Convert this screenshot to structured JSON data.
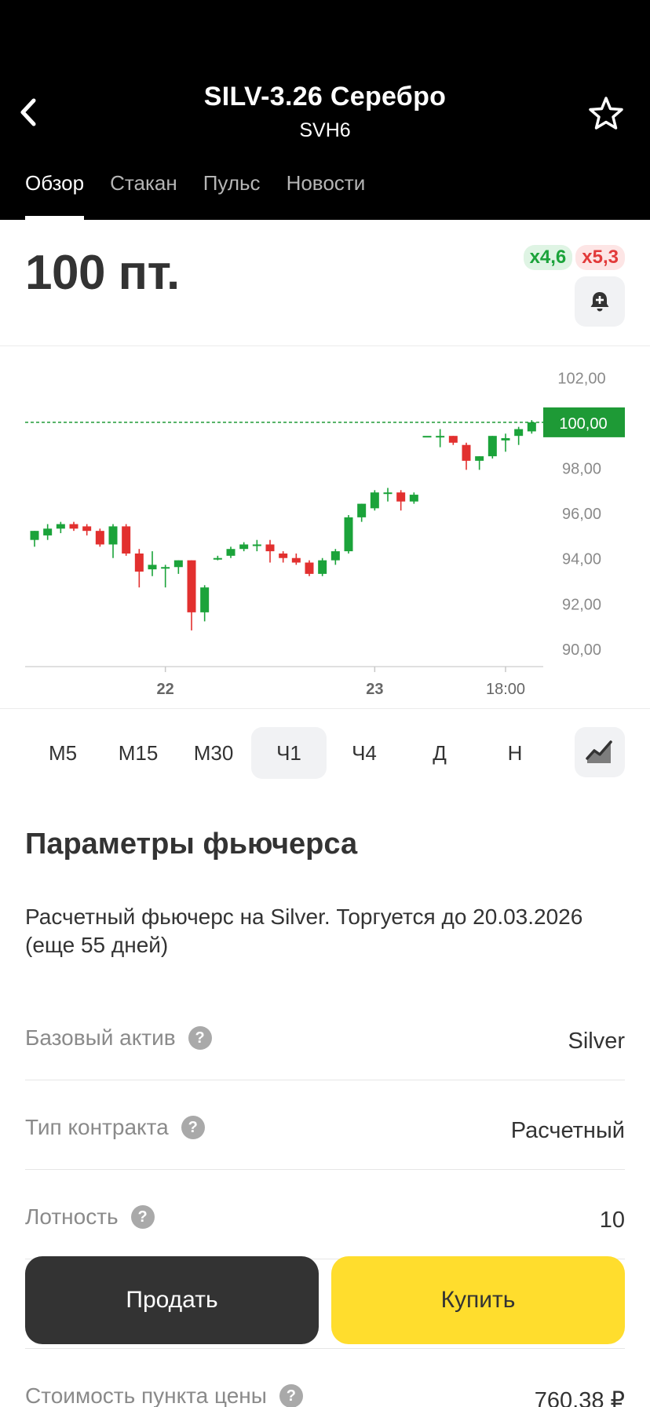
{
  "header": {
    "title": "SILV-3.26 Серебро",
    "subtitle": "SVH6",
    "tabs": [
      {
        "label": "Обзор",
        "active": true
      },
      {
        "label": "Стакан",
        "active": false
      },
      {
        "label": "Пульс",
        "active": false
      },
      {
        "label": "Новости",
        "active": false
      }
    ]
  },
  "price": {
    "value": "100 пт.",
    "leverage_long": "x4,6",
    "leverage_short": "x5,3"
  },
  "chart_data": {
    "type": "candlestick",
    "current_price": 100.0,
    "current_price_label": "100,00",
    "ylim": [
      89.2,
      102.6
    ],
    "y_ticks": [
      {
        "value": 102,
        "label": "102,00"
      },
      {
        "value": 98,
        "label": "98,00"
      },
      {
        "value": 96,
        "label": "96,00"
      },
      {
        "value": 94,
        "label": "94,00"
      },
      {
        "value": 92,
        "label": "92,00"
      },
      {
        "value": 90,
        "label": "90,00"
      }
    ],
    "x_ticks": [
      {
        "index": 10,
        "label": "22"
      },
      {
        "index": 26,
        "label": "23"
      },
      {
        "index": 36,
        "label": "18:00"
      }
    ],
    "candles": [
      {
        "o": 94.8,
        "h": 95.2,
        "l": 94.5,
        "c": 95.2
      },
      {
        "o": 95.0,
        "h": 95.5,
        "l": 94.8,
        "c": 95.3
      },
      {
        "o": 95.3,
        "h": 95.6,
        "l": 95.1,
        "c": 95.5
      },
      {
        "o": 95.5,
        "h": 95.6,
        "l": 95.2,
        "c": 95.3
      },
      {
        "o": 95.4,
        "h": 95.5,
        "l": 95.0,
        "c": 95.2
      },
      {
        "o": 95.2,
        "h": 95.3,
        "l": 94.5,
        "c": 94.6
      },
      {
        "o": 94.6,
        "h": 95.5,
        "l": 94.0,
        "c": 95.4
      },
      {
        "o": 95.4,
        "h": 95.5,
        "l": 94.1,
        "c": 94.2
      },
      {
        "o": 94.2,
        "h": 94.4,
        "l": 92.7,
        "c": 93.4
      },
      {
        "o": 93.5,
        "h": 94.3,
        "l": 93.2,
        "c": 93.7
      },
      {
        "o": 93.6,
        "h": 93.7,
        "l": 92.7,
        "c": 93.6
      },
      {
        "o": 93.6,
        "h": 93.9,
        "l": 93.3,
        "c": 93.9
      },
      {
        "o": 93.9,
        "h": 93.9,
        "l": 90.8,
        "c": 91.6
      },
      {
        "o": 91.6,
        "h": 92.8,
        "l": 91.2,
        "c": 92.7
      },
      {
        "o": 94.0,
        "h": 94.1,
        "l": 93.9,
        "c": 94.0
      },
      {
        "o": 94.1,
        "h": 94.5,
        "l": 94.0,
        "c": 94.4
      },
      {
        "o": 94.4,
        "h": 94.7,
        "l": 94.3,
        "c": 94.6
      },
      {
        "o": 94.6,
        "h": 94.8,
        "l": 94.3,
        "c": 94.6
      },
      {
        "o": 94.6,
        "h": 94.8,
        "l": 93.8,
        "c": 94.3
      },
      {
        "o": 94.2,
        "h": 94.3,
        "l": 93.8,
        "c": 94.0
      },
      {
        "o": 94.0,
        "h": 94.2,
        "l": 93.7,
        "c": 93.8
      },
      {
        "o": 93.8,
        "h": 93.9,
        "l": 93.2,
        "c": 93.3
      },
      {
        "o": 93.3,
        "h": 94.0,
        "l": 93.2,
        "c": 93.9
      },
      {
        "o": 93.9,
        "h": 94.4,
        "l": 93.7,
        "c": 94.3
      },
      {
        "o": 94.3,
        "h": 95.9,
        "l": 94.2,
        "c": 95.8
      },
      {
        "o": 95.8,
        "h": 96.4,
        "l": 95.6,
        "c": 96.4
      },
      {
        "o": 96.2,
        "h": 97.0,
        "l": 96.1,
        "c": 96.9
      },
      {
        "o": 96.9,
        "h": 97.1,
        "l": 96.5,
        "c": 96.9
      },
      {
        "o": 96.9,
        "h": 97.0,
        "l": 96.1,
        "c": 96.5
      },
      {
        "o": 96.5,
        "h": 96.9,
        "l": 96.4,
        "c": 96.8
      },
      {
        "o": 99.4,
        "h": 99.4,
        "l": 99.4,
        "c": 99.4
      },
      {
        "o": 99.4,
        "h": 99.7,
        "l": 98.9,
        "c": 99.4
      },
      {
        "o": 99.4,
        "h": 99.4,
        "l": 99.0,
        "c": 99.1
      },
      {
        "o": 99.0,
        "h": 99.1,
        "l": 97.9,
        "c": 98.3
      },
      {
        "o": 98.3,
        "h": 98.5,
        "l": 97.9,
        "c": 98.5
      },
      {
        "o": 98.5,
        "h": 99.4,
        "l": 98.4,
        "c": 99.4
      },
      {
        "o": 99.2,
        "h": 99.5,
        "l": 98.7,
        "c": 99.3
      },
      {
        "o": 99.4,
        "h": 99.8,
        "l": 99.0,
        "c": 99.7
      },
      {
        "o": 99.6,
        "h": 100.1,
        "l": 99.5,
        "c": 100.0
      }
    ]
  },
  "periods": [
    {
      "label": "M5",
      "active": false
    },
    {
      "label": "M15",
      "active": false
    },
    {
      "label": "M30",
      "active": false
    },
    {
      "label": "Ч1",
      "active": true
    },
    {
      "label": "Ч4",
      "active": false
    },
    {
      "label": "Д",
      "active": false
    },
    {
      "label": "Н",
      "active": false
    }
  ],
  "params": {
    "title": "Параметры фьючерса",
    "description": "Расчетный фьючерс на Silver. Торгуется до 20.03.2026 (еще 55 дней)",
    "rows": [
      {
        "label": "Базовый актив",
        "value": "Silver"
      },
      {
        "label": "Тип контракта",
        "value": "Расчетный"
      },
      {
        "label": "Лотность",
        "value": "10"
      },
      {
        "label": "",
        "value": ""
      },
      {
        "label": "Стоимость пункта цены",
        "value": "760,38 ₽"
      }
    ]
  },
  "actions": {
    "sell_label": "Продать",
    "buy_label": "Купить"
  },
  "colors": {
    "up": "#1ba33a",
    "down": "#e2302f",
    "price_line": "#1e9a36",
    "buy": "#ffdd2d",
    "sell": "#333333"
  }
}
